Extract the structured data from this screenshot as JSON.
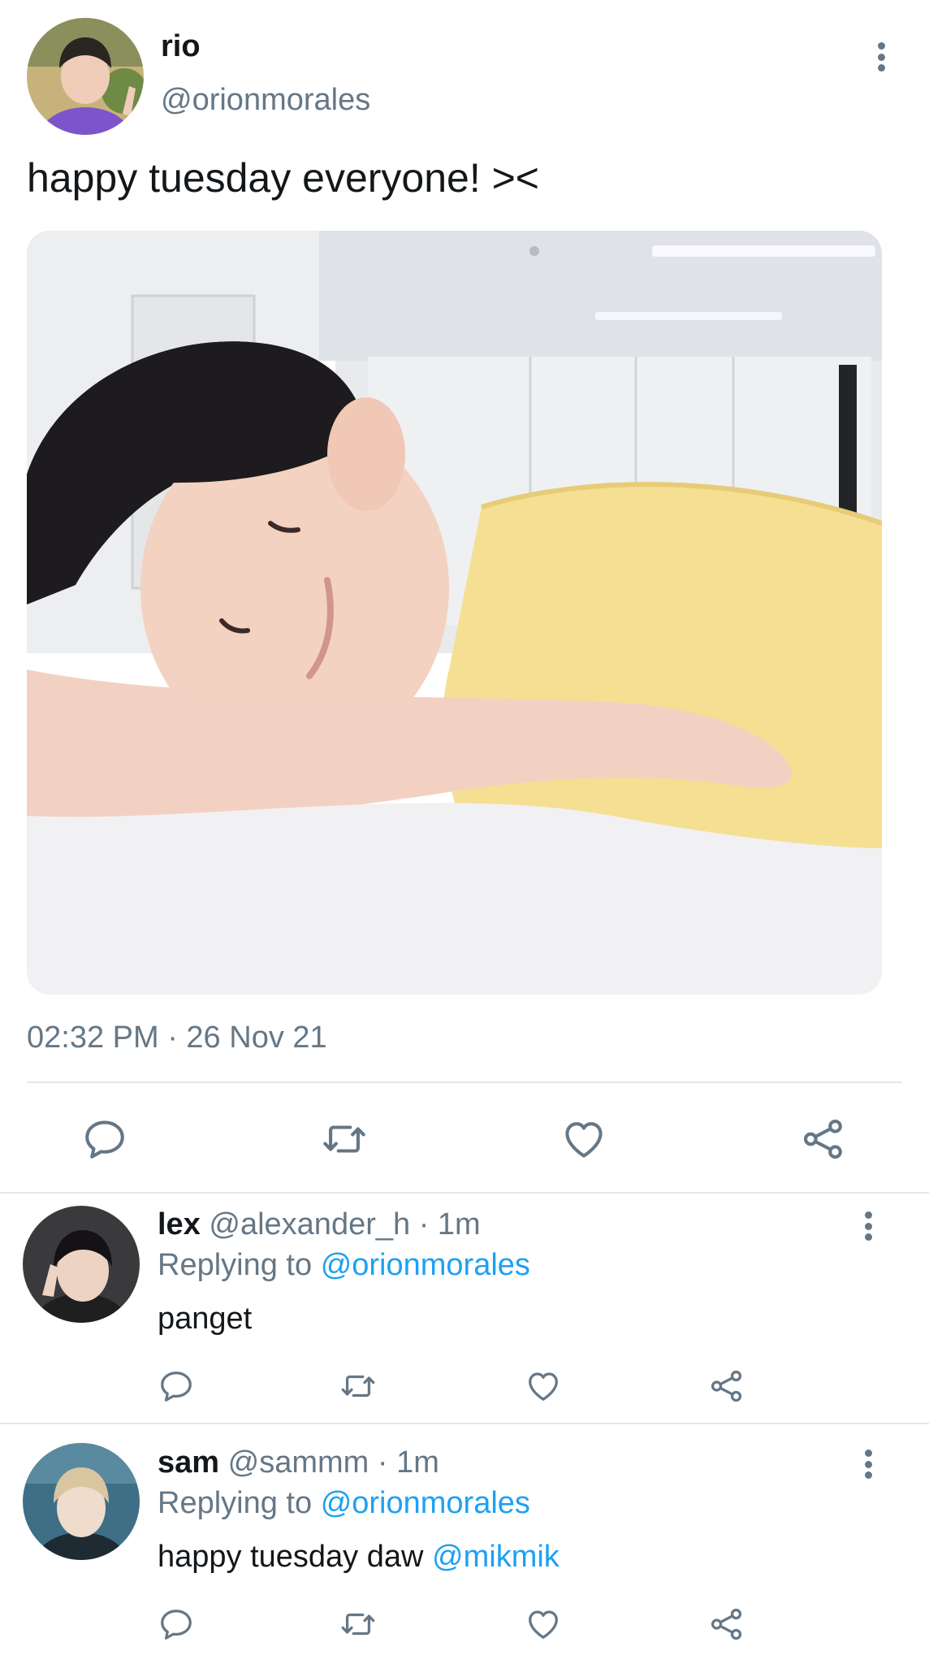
{
  "tweet": {
    "name": "rio",
    "handle": "@orionmorales",
    "text": "happy tuesday everyone! ><",
    "timestamp": "02:32 PM · 26 Nov 21",
    "media_alt": "selfie photo of a person resting their head on a white table, wearing a yellow t-shirt"
  },
  "replies": [
    {
      "name": "lex",
      "handle": "@alexander_h",
      "time": "· 1m",
      "replying_prefix": "Replying to",
      "replying_handle": "@orionmorales",
      "text": "panget",
      "mention": ""
    },
    {
      "name": "sam",
      "handle": "@sammm",
      "time": "· 1m",
      "replying_prefix": "Replying to",
      "replying_handle": "@orionmorales",
      "text": "happy tuesday daw",
      "mention": "@mikmik"
    }
  ],
  "icons": {
    "reply": "reply-icon",
    "retweet": "retweet-icon",
    "like": "heart-icon",
    "share": "share-icon",
    "more": "more-vertical-icon"
  },
  "colors": {
    "text": "#14171a",
    "muted": "#657786",
    "link": "#1da1f2",
    "divider": "#e1e8ed"
  }
}
